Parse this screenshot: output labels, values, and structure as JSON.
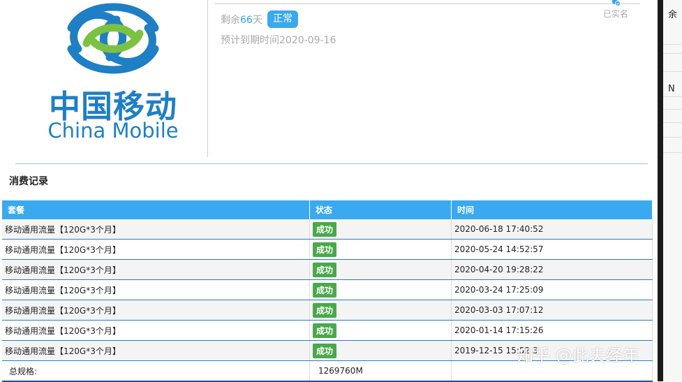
{
  "logo": {
    "cn": "中国移动",
    "en": "China Mobile"
  },
  "plan": {
    "remain_prefix": "剩余",
    "remain_days": "66",
    "remain_suffix": "天",
    "status": "正常",
    "expire": "预计到期时间2020-09-16"
  },
  "verified_label": "已实名",
  "right_panel": {
    "text_top": "余",
    "text_n": "N"
  },
  "section_title": "消费记录",
  "table": {
    "headers": [
      "套餐",
      "状态",
      "时间"
    ],
    "rows": [
      {
        "plan": "移动通用流量【120G*3个月】",
        "status": "成功",
        "time": "2020-06-18 17:40:52"
      },
      {
        "plan": "移动通用流量【120G*3个月】",
        "status": "成功",
        "time": "2020-05-24 14:52:57"
      },
      {
        "plan": "移动通用流量【120G*3个月】",
        "status": "成功",
        "time": "2020-04-20 19:28:22"
      },
      {
        "plan": "移动通用流量【120G*3个月】",
        "status": "成功",
        "time": "2020-03-24 17:25:09"
      },
      {
        "plan": "移动通用流量【120G*3个月】",
        "status": "成功",
        "time": "2020-03-03 17:07:12"
      },
      {
        "plan": "移动通用流量【120G*3个月】",
        "status": "成功",
        "time": "2020-01-14 17:15:26"
      },
      {
        "plan": "移动通用流量【120G*3个月】",
        "status": "成功",
        "time": "2019-12-15 15:52:3"
      }
    ],
    "total_label": "总规格:",
    "total_value": "1269760M"
  },
  "watermark": "知乎 @此夫经年",
  "colors": {
    "accent": "#3aa9ef",
    "success": "#4aa84a",
    "brand": "#1f7fc4"
  }
}
